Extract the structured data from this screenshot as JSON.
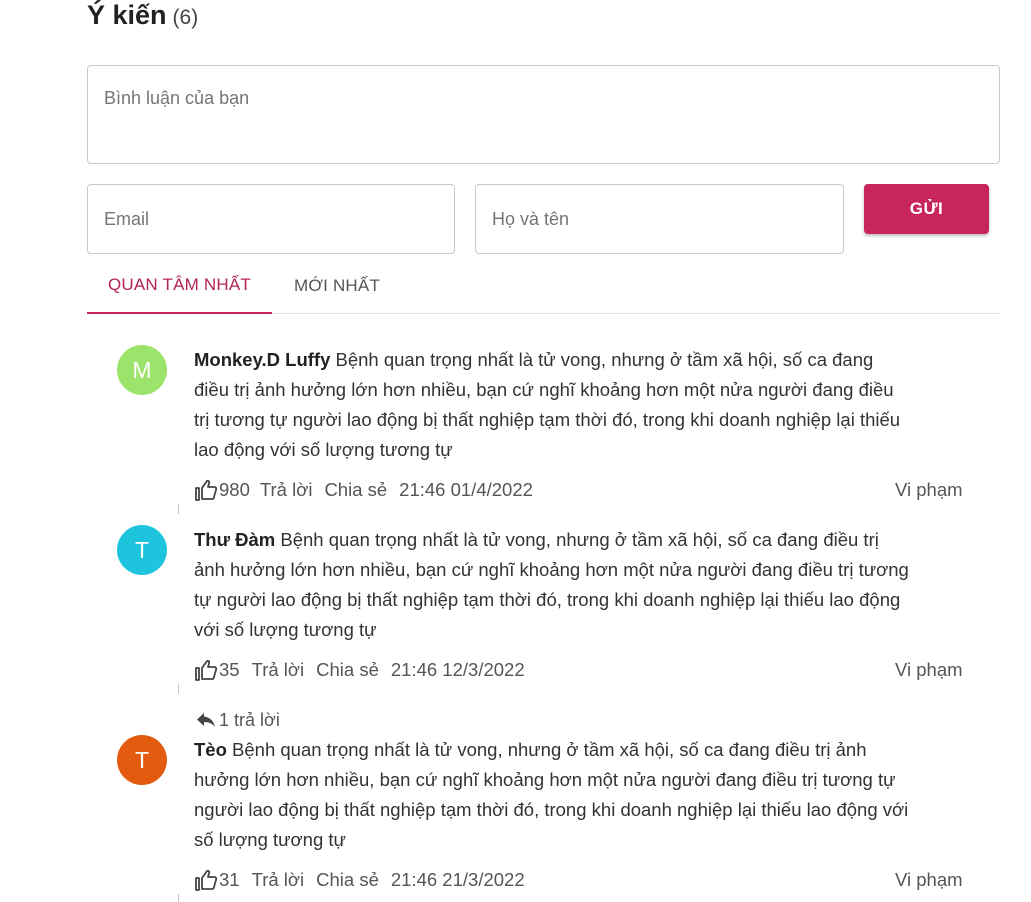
{
  "header": {
    "title": "Ý kiến",
    "count": "(6)"
  },
  "form": {
    "comment_placeholder": "Bình luận của bạn",
    "email_placeholder": "Email",
    "name_placeholder": "Họ và tên",
    "send_label": "GỬI"
  },
  "tabs": [
    {
      "label": "QUAN TÂM NHẤT",
      "active": true
    },
    {
      "label": "MỚI NHẤT",
      "active": false
    }
  ],
  "comments": [
    {
      "avatar_letter": "M",
      "avatar_color": "#9be36b",
      "author": "Monkey.D Luffy",
      "text": " Bệnh quan trọng nhất là tử vong, nhưng ở tầm xã hội, số ca đang điều trị ảnh hưởng lớn hơn nhiều, bạn cứ nghĩ khoảng hơn một nửa người đang điều trị tương tự người lao động bị thất nghiệp tạm thời đó, trong khi doanh nghiệp lại thiếu lao động với số lượng tương tự",
      "likes": "980",
      "reply_label": "Trả lời",
      "share_label": "Chia sẻ",
      "timestamp": "21:46 01/4/2022",
      "report_label": "Vi phạm"
    },
    {
      "avatar_letter": "T",
      "avatar_color": "#1ec4de",
      "author": "Thư Đàm",
      "text": " Bệnh quan trọng nhất là tử vong, nhưng ở tầm xã hội, số ca đang điều trị ảnh hưởng lớn hơn nhiều, bạn cứ nghĩ khoảng hơn một nửa người đang điều trị tương tự người lao động bị thất nghiệp tạm thời đó, trong khi doanh nghiệp lại thiếu lao động với số lượng tương tự",
      "likes": "35",
      "reply_label": "Trả lời",
      "share_label": "Chia sẻ",
      "timestamp": "21:46 12/3/2022",
      "report_label": "Vi phạm",
      "replies_label": "1 trả lời"
    },
    {
      "avatar_letter": "T",
      "avatar_color": "#e25b0f",
      "author": "Tèo",
      "text": " Bệnh quan trọng nhất là tử vong, nhưng ở tầm xã hội, số ca đang điều trị ảnh hưởng lớn hơn nhiều, bạn cứ nghĩ khoảng hơn một nửa người đang điều trị tương tự người lao động bị thất nghiệp tạm thời đó, trong khi doanh nghiệp lại thiếu lao động với số lượng tương tự",
      "likes": "31",
      "reply_label": "Trả lời",
      "share_label": "Chia sẻ",
      "timestamp": "21:46 21/3/2022",
      "report_label": "Vi phạm"
    }
  ],
  "colors": {
    "accent": "#c8265a",
    "tab_active_text": "#b32450"
  }
}
